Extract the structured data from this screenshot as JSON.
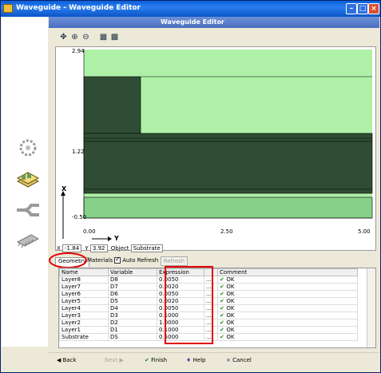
{
  "window": {
    "title": "Waveguide - Waveguide Editor"
  },
  "panel": {
    "title": "Waveguide Editor"
  },
  "toolbar": {
    "icons": [
      "select-icon",
      "zoom-in-icon",
      "zoom-out-icon",
      "fit-icon",
      "grid-icon"
    ]
  },
  "plot": {
    "y_ticks": [
      "2.94",
      "1.22",
      "-0.50"
    ],
    "x_ticks": [
      "0.00",
      "2.50",
      "5.00"
    ],
    "x_axis_label": "Y",
    "y_axis_label": "X",
    "colors": {
      "light": "#aef0a8",
      "dark": "#2f4d34",
      "mid": "#3c5b40",
      "bottom": "#86d08a"
    }
  },
  "coords": {
    "x_label": "X",
    "x_value": "-1.84",
    "y_label": "Y",
    "y_value": "3.92",
    "object_label": "Object",
    "object_value": "Substrate"
  },
  "tabs": {
    "geometry": "Geometry",
    "materials": "Materials",
    "auto_refresh": "Auto Refresh",
    "refresh": "Refresh"
  },
  "table": {
    "headers": [
      "Name",
      "Variable",
      "Expression",
      "",
      "Comment"
    ],
    "rows": [
      {
        "name": "Layer8",
        "variable": "D8",
        "expression": "0.0050",
        "status": "OK"
      },
      {
        "name": "Layer7",
        "variable": "D7",
        "expression": "0.0020",
        "status": "OK"
      },
      {
        "name": "Layer6",
        "variable": "D6",
        "expression": "0.0050",
        "status": "OK"
      },
      {
        "name": "Layer5",
        "variable": "D5",
        "expression": "0.0020",
        "status": "OK"
      },
      {
        "name": "Layer4",
        "variable": "D4",
        "expression": "0.0050",
        "status": "OK"
      },
      {
        "name": "Layer3",
        "variable": "D3",
        "expression": "0.1000",
        "status": "OK"
      },
      {
        "name": "Layer2",
        "variable": "D2",
        "expression": "1.0000",
        "status": "OK"
      },
      {
        "name": "Layer1",
        "variable": "D1",
        "expression": "0.1000",
        "status": "OK"
      },
      {
        "name": "Substrate",
        "variable": "DS",
        "expression": "0.5000",
        "status": "OK"
      }
    ]
  },
  "footer": {
    "back": "Back",
    "next": "Next",
    "finish": "Finish",
    "help": "Help",
    "cancel": "Cancel"
  }
}
